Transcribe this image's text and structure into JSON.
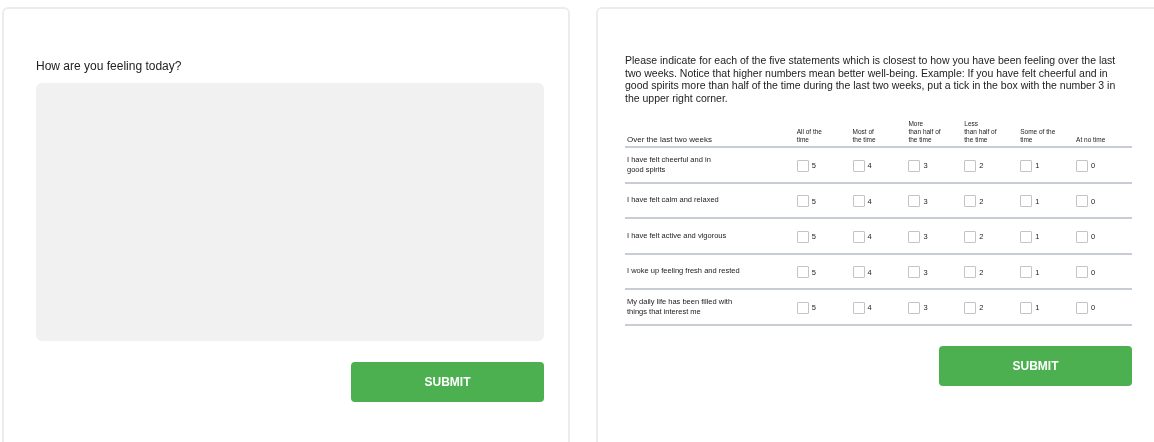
{
  "left_card": {
    "question": "How are you feeling today?",
    "submit": "SUBMIT"
  },
  "right_card": {
    "instructions": "Please indicate for each of the five statements which is closest to how you have been feeling over the last two weeks.  Notice that higher numbers mean better well-being.  Example: If you have felt cheerful and in good spirits more than half of the time during the last two weeks, put a tick in  the box with the number 3 in the upper right corner.",
    "table": {
      "columns": [
        "Over the last two weeks",
        "All of  the\ntime",
        "Most of\nthe  time",
        "More\nthan  half of\nthe  time",
        "Less\nthan  half of\nthe  time",
        "Some of  the\ntime",
        "At no time"
      ],
      "rows": [
        {
          "statement": "I have felt cheerful and in\ngood  spirits",
          "options": [
            {
              "label": "5",
              "checked": false
            },
            {
              "label": "4",
              "checked": false
            },
            {
              "label": "3",
              "checked": false
            },
            {
              "label": "2",
              "checked": false
            },
            {
              "label": "1",
              "checked": false
            },
            {
              "label": "0",
              "checked": false
            }
          ]
        },
        {
          "statement": "I have felt calm and  relaxed",
          "options": [
            {
              "label": "5",
              "checked": false
            },
            {
              "label": "4",
              "checked": false
            },
            {
              "label": "3",
              "checked": false
            },
            {
              "label": "2",
              "checked": false
            },
            {
              "label": "1",
              "checked": false
            },
            {
              "label": "0",
              "checked": false
            }
          ]
        },
        {
          "statement": "I have felt active and vigorous",
          "options": [
            {
              "label": "5",
              "checked": false
            },
            {
              "label": "4",
              "checked": false
            },
            {
              "label": "3",
              "checked": false
            },
            {
              "label": "2",
              "checked": false
            },
            {
              "label": "1",
              "checked": false
            },
            {
              "label": "0",
              "checked": false
            }
          ]
        },
        {
          "statement": "I woke up feeling fresh and rested",
          "options": [
            {
              "label": "5",
              "checked": false
            },
            {
              "label": "4",
              "checked": false
            },
            {
              "label": "3",
              "checked": false
            },
            {
              "label": "2",
              "checked": false
            },
            {
              "label": "1",
              "checked": false
            },
            {
              "label": "0",
              "checked": false
            }
          ]
        },
        {
          "statement": "My daily life has been filled  with\nthings that interest me",
          "options": [
            {
              "label": "5",
              "checked": false
            },
            {
              "label": "4",
              "checked": false
            },
            {
              "label": "3",
              "checked": false
            },
            {
              "label": "2",
              "checked": false
            },
            {
              "label": "1",
              "checked": false
            },
            {
              "label": "0",
              "checked": false
            }
          ]
        }
      ]
    },
    "submit": "SUBMIT"
  }
}
